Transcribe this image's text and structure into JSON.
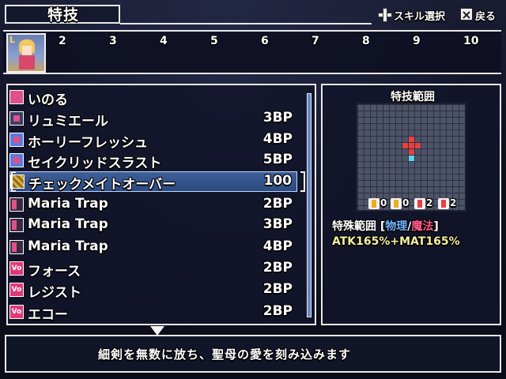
{
  "header": {
    "title": "特技",
    "hint_select": "スキル選択",
    "hint_back": "戻る",
    "select_icon": "dpad-icon",
    "back_icon": "x-button-icon"
  },
  "party": {
    "slots": [
      "2",
      "3",
      "4",
      "5",
      "6",
      "7",
      "8",
      "9",
      "10"
    ],
    "leader_marker": "L"
  },
  "skills": [
    {
      "name": "いのる",
      "cost": "",
      "icon": "prayer-icon",
      "color": "#e0508a"
    },
    {
      "name": "リュミエール",
      "cost": "3BP",
      "icon": "pink-square-icon",
      "color": "#e0508a"
    },
    {
      "name": "ホーリーフレッシュ",
      "cost": "4BP",
      "icon": "blue-pink-square-icon",
      "color": "#5a7ae0"
    },
    {
      "name": "セイクリッドスラスト",
      "cost": "5BP",
      "icon": "blue-pink-square-icon",
      "color": "#5a7ae0"
    },
    {
      "name": "チェックメイトオーバー",
      "cost": "100",
      "icon": "gold-pattern-icon",
      "color": "#d8b040",
      "selected": true
    },
    {
      "name": "Maria Trap",
      "cost": "2BP",
      "icon": "trap-icon",
      "color": "#e0508a"
    },
    {
      "name": "Maria Trap",
      "cost": "3BP",
      "icon": "trap-plus-icon",
      "color": "#e0508a"
    },
    {
      "name": "Maria Trap",
      "cost": "4BP",
      "icon": "trap-plus2-icon",
      "color": "#e0508a"
    },
    {
      "name": "フォース",
      "cost": "2BP",
      "icon": "vo-icon",
      "color": "#e03878"
    },
    {
      "name": "レジスト",
      "cost": "2BP",
      "icon": "vo-icon",
      "color": "#e03878"
    },
    {
      "name": "エコー",
      "cost": "2BP",
      "icon": "vo-icon",
      "color": "#e03878"
    }
  ],
  "info": {
    "range_title": "特技範囲",
    "stats": [
      "0",
      "0",
      "2",
      "2"
    ],
    "special_label": "特殊範囲 [",
    "physical": "物理",
    "slash": "/",
    "magic": "魔法",
    "close_bracket": "]",
    "formula": "ATK165%+MAT165%",
    "colors": {
      "physical": "#6fb4ff",
      "magic": "#ff5a8a",
      "formula": "#f4f0a0",
      "target": "#e84040",
      "origin": "#5ad6e8"
    }
  },
  "description": "細剣を無数に放ち、聖母の愛を刻み込みます"
}
